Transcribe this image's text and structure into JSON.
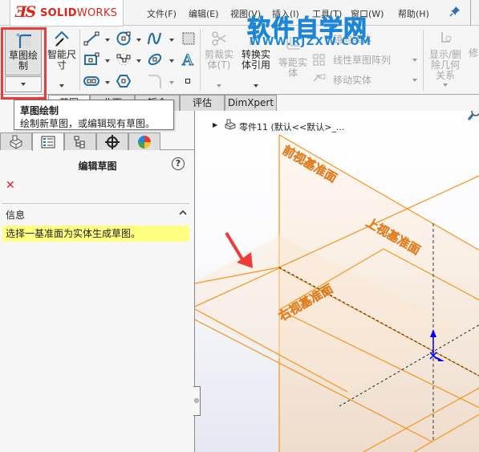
{
  "app": {
    "logo_mark": "ƎS",
    "logo_bold": "SOLID",
    "logo_thin": "WORKS"
  },
  "menu": [
    {
      "label": "文件(F)"
    },
    {
      "label": "编辑(E)"
    },
    {
      "label": "视图(V)"
    },
    {
      "label": "插入(I)"
    },
    {
      "label": "工具(T)"
    },
    {
      "label": "窗口(W)"
    },
    {
      "label": "帮助(H)"
    }
  ],
  "watermark": {
    "title": "软件自学网",
    "url": "WWW.RJZXW.COM"
  },
  "toolbar": {
    "sketch_label_1": "草图绘",
    "sketch_label_2": "制",
    "smart_dim_label_1": "智能尺",
    "smart_dim_label_2": "寸",
    "trim_label_1": "剪裁实",
    "trim_label_2": "体(T)",
    "convert_label_1": "转换实",
    "convert_label_2": "体引用",
    "offset_label_1": "等距实",
    "offset_label_2": "体",
    "mirror_label": "镜向实体",
    "linear_pattern_label": "线性草图阵列",
    "move_label": "移动实体",
    "relations_label_1": "显示/删",
    "relations_label_2": "除几何",
    "relations_label_3": "关系",
    "repair_label": "修"
  },
  "tabs": [
    {
      "label": "特征"
    },
    {
      "label": "草图"
    },
    {
      "label": "曲面"
    },
    {
      "label": "钣金"
    },
    {
      "label": "评估"
    },
    {
      "label": "DimXpert"
    }
  ],
  "tooltip": {
    "title": "草图绘制",
    "description": "绘制新草图，或编辑现有草图。"
  },
  "property_manager": {
    "title": "编辑草图",
    "help": "?",
    "cancel": "✕",
    "info_label": "信息",
    "info_message": "选择一基准面为实体生成草图。"
  },
  "feature_tree": {
    "part_label": "零件11  (默认<<默认>_..."
  },
  "planes": {
    "front": "前视基准面",
    "top": "上视基准面",
    "right": "右视基准面"
  },
  "colors": {
    "plane_edge": "#f7941d",
    "plane_label": "#f59a3a",
    "highlight_red": "#ef3a3a",
    "info_bg": "#ffff80",
    "origin_blue": "#0000ff"
  }
}
